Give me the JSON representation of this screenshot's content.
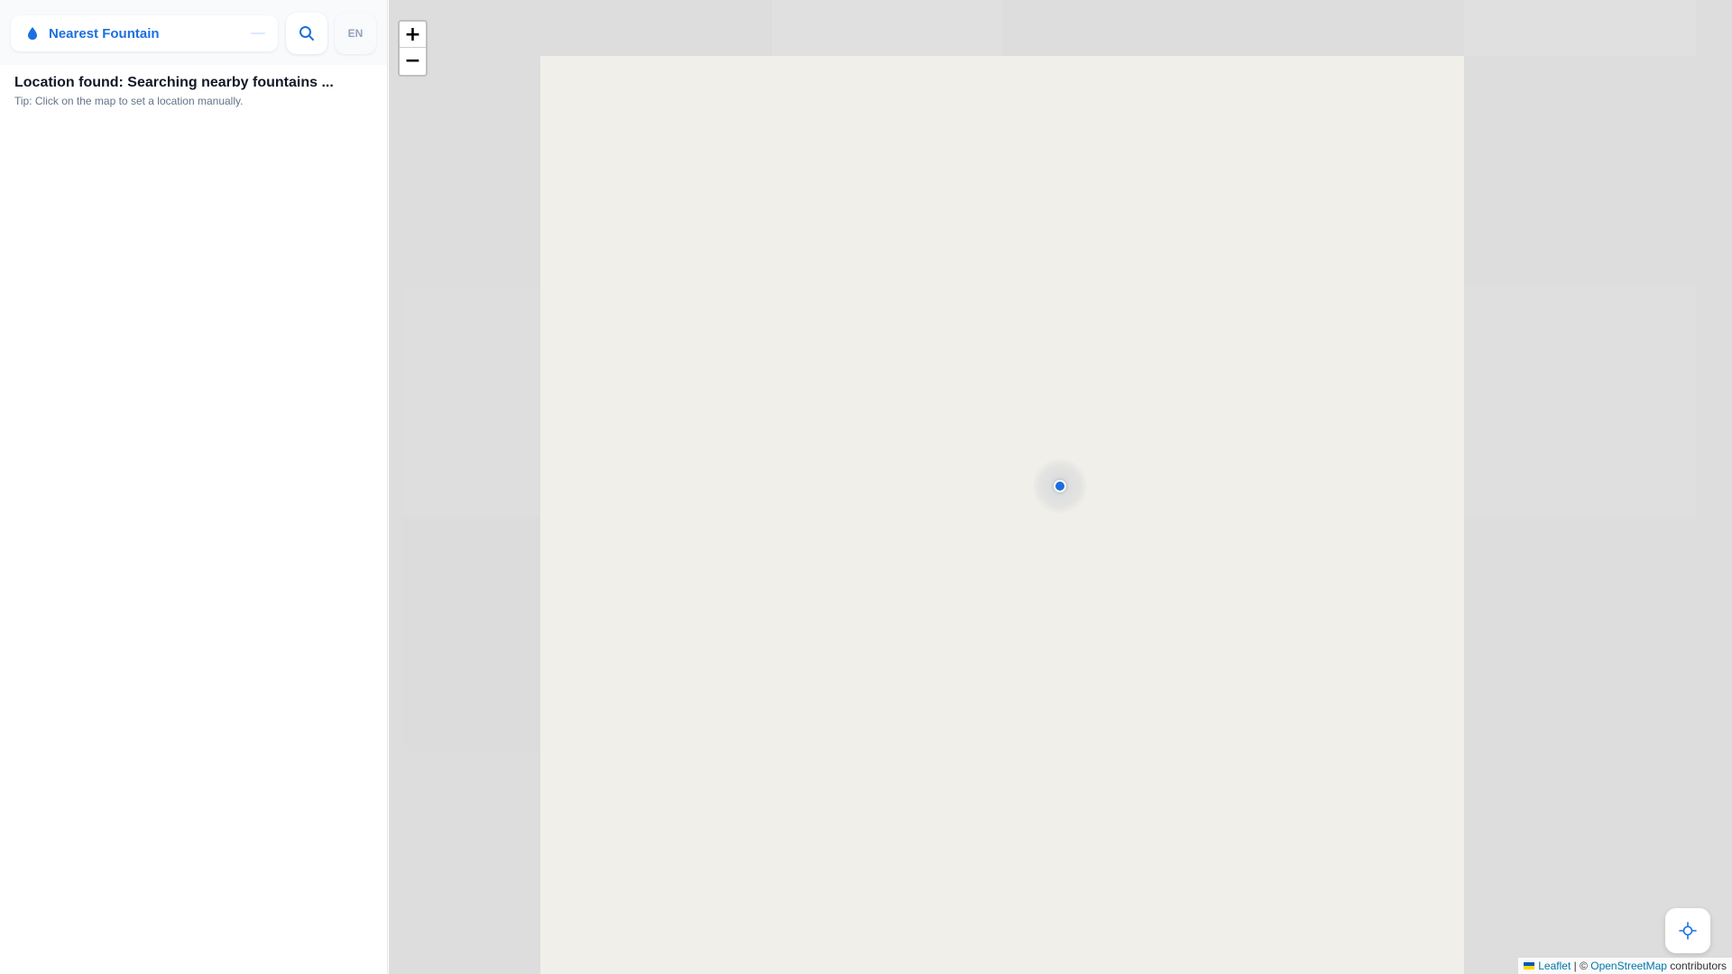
{
  "app": {
    "title": "Nearest Fountain",
    "language": "EN"
  },
  "status": {
    "title": "Location found: Searching nearby fountains ...",
    "tip": "Tip: Click on the map to set a location manually."
  },
  "map": {
    "zoom_in_label": "+",
    "zoom_out_label": "−",
    "attribution": {
      "leaflet": "Leaflet",
      "separator": " | © ",
      "osm": "OpenStreetMap",
      "contributors": " contributors"
    }
  },
  "icons": {
    "brand": "water-drop-icon",
    "search": "search-icon",
    "locate": "crosshair-icon",
    "location": "current-location-icon"
  },
  "colors": {
    "accent": "#1d6fe0",
    "land": "#f1efe9",
    "map_background": "#dddddd"
  }
}
